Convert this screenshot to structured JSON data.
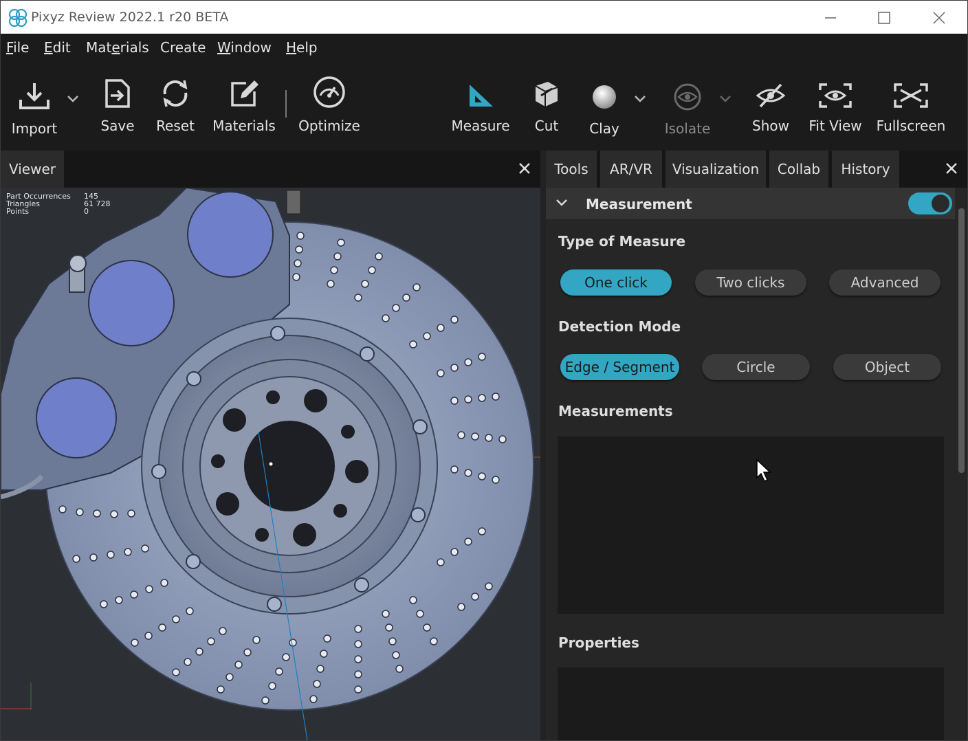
{
  "window": {
    "title": "Pixyz Review 2022.1 r20 BETA",
    "buttons": [
      "minimize-icon",
      "maximize-icon",
      "close-icon"
    ]
  },
  "menu": [
    {
      "label": "File",
      "u": "F",
      "rest": "ile"
    },
    {
      "label": "Edit",
      "u": "E",
      "rest": "dit"
    },
    {
      "label": "Materials",
      "pre": "Mat",
      "u": "e",
      "rest": "rials"
    },
    {
      "label": "Create"
    },
    {
      "label": "Window",
      "u": "W",
      "rest": "indow"
    },
    {
      "label": "Help",
      "u": "H",
      "rest": "elp"
    }
  ],
  "toolbar": {
    "import": "Import",
    "save": "Save",
    "reset": "Reset",
    "materials": "Materials",
    "optimize": "Optimize",
    "measure": "Measure",
    "cut": "Cut",
    "clay": "Clay",
    "isolate": "Isolate",
    "show": "Show",
    "fit_view": "Fit View",
    "fullscreen": "Fullscreen"
  },
  "viewer": {
    "tab": "Viewer",
    "stats": [
      {
        "label": "Part Occurrences",
        "value": "145"
      },
      {
        "label": "Triangles",
        "value": "61 728"
      },
      {
        "label": "Points",
        "value": "0"
      }
    ]
  },
  "panel": {
    "tabs": [
      "Tools",
      "AR/VR",
      "Visualization",
      "Collab",
      "History"
    ],
    "section_title": "Measurement",
    "section_enabled": true,
    "type_label": "Type of Measure",
    "type_options": [
      "One click",
      "Two clicks",
      "Advanced"
    ],
    "type_selected": "One click",
    "detection_label": "Detection Mode",
    "detection_options": [
      "Edge / Segment",
      "Circle",
      "Object"
    ],
    "detection_selected": "Edge / Segment",
    "measurements_label": "Measurements",
    "properties_label": "Properties"
  },
  "colors": {
    "accent": "#33a6c4",
    "pad": "#6f7fc9",
    "disc": "#8c9bb8"
  }
}
